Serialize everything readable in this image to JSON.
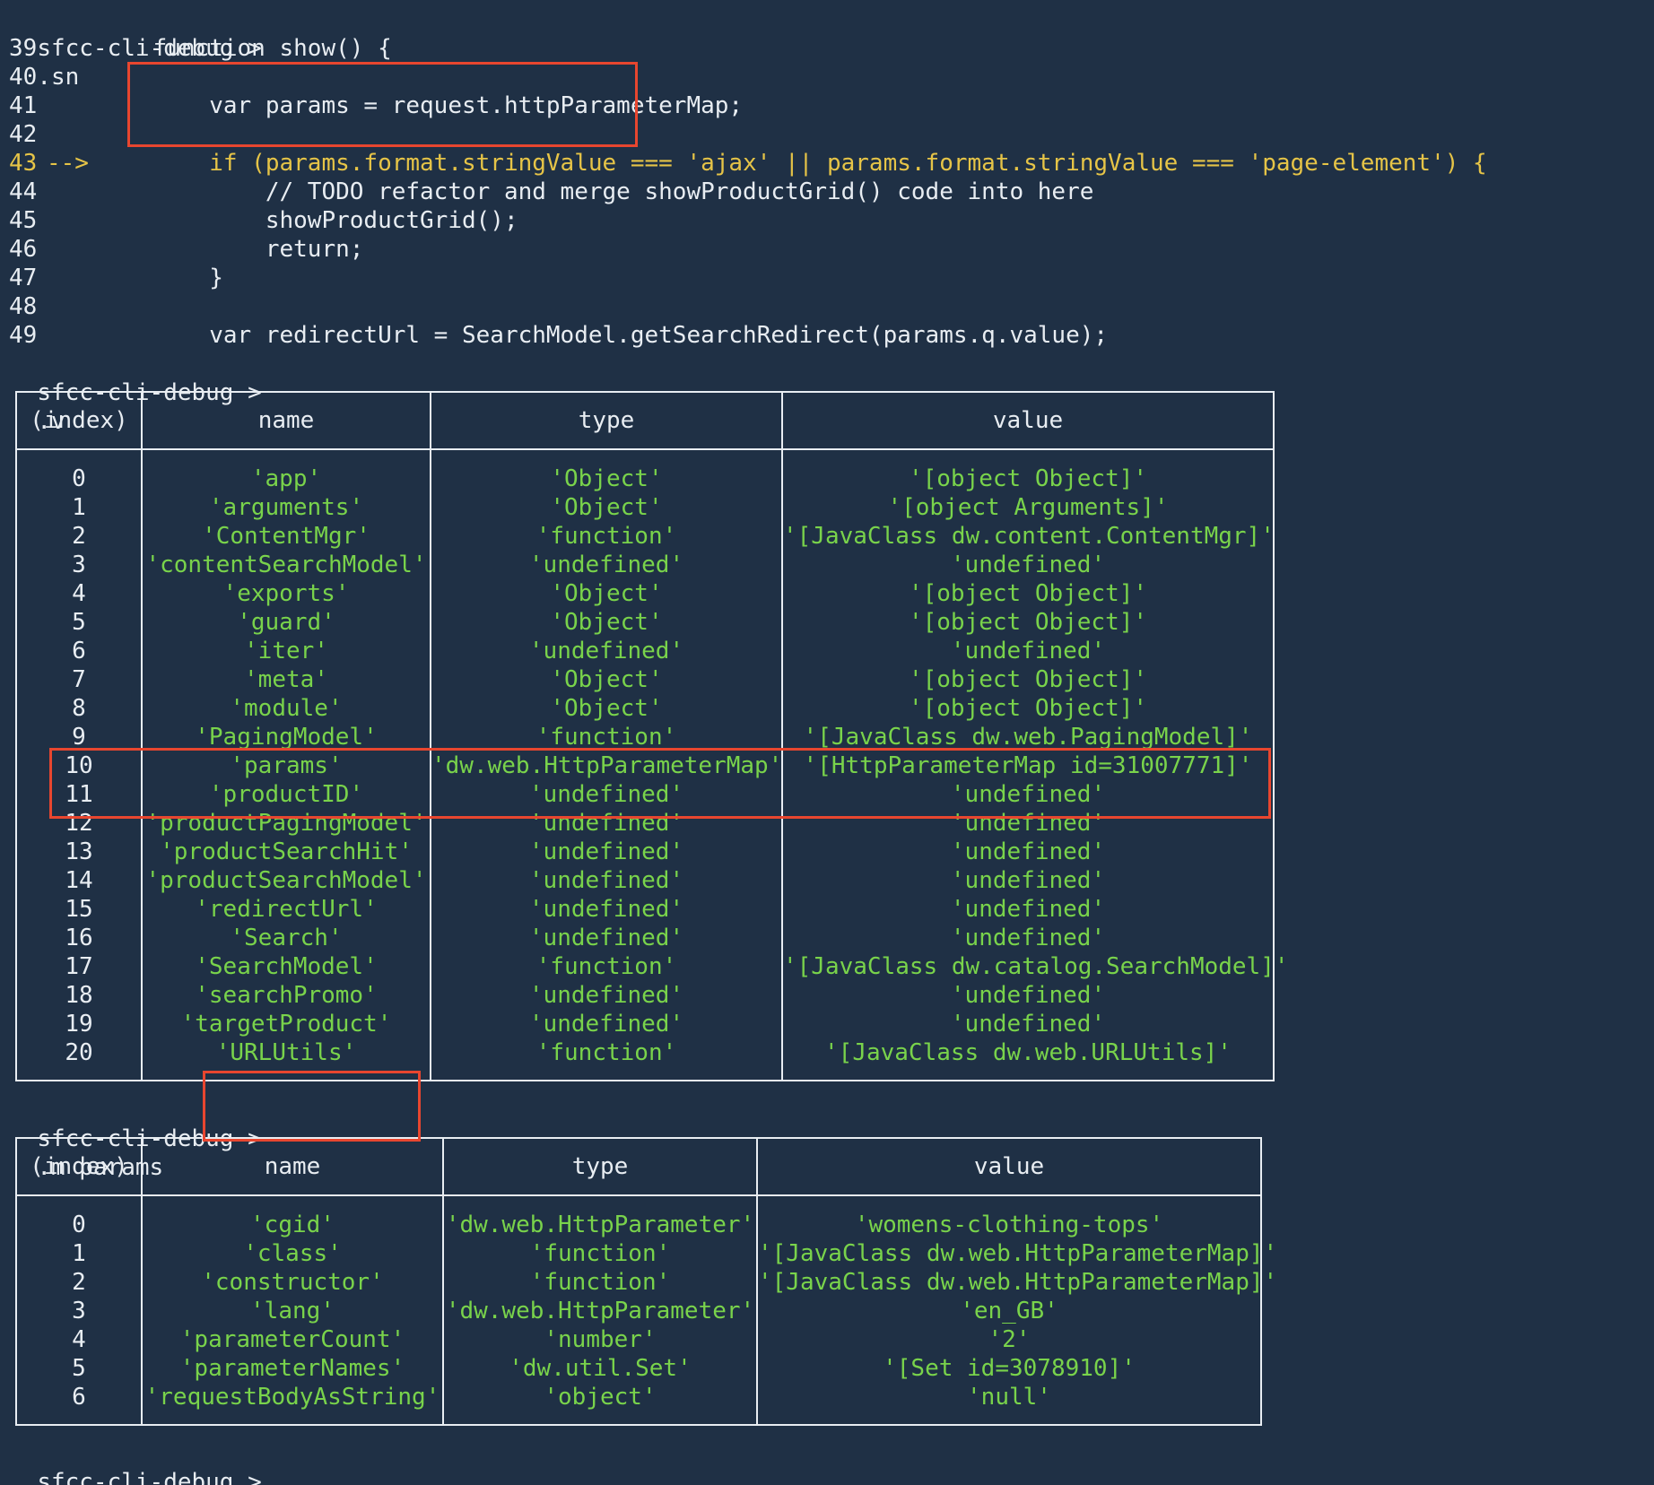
{
  "prompt": "sfcc-cli-debug >",
  "commands": {
    "source": ".sn",
    "variables": ".v",
    "members": ".m params",
    "current": ""
  },
  "code_lines": [
    {
      "num": "39",
      "marker": "",
      "text": "    function show() {"
    },
    {
      "num": "40",
      "marker": "",
      "text": ""
    },
    {
      "num": "41",
      "marker": "",
      "text": "        var params = request.httpParameterMap;"
    },
    {
      "num": "42",
      "marker": "",
      "text": ""
    },
    {
      "num": "43",
      "marker": "-->",
      "text": "        if (params.format.stringValue === 'ajax' || params.format.stringValue === 'page-element') {"
    },
    {
      "num": "44",
      "marker": "",
      "text": "            // TODO refactor and merge showProductGrid() code into here"
    },
    {
      "num": "45",
      "marker": "",
      "text": "            showProductGrid();"
    },
    {
      "num": "46",
      "marker": "",
      "text": "            return;"
    },
    {
      "num": "47",
      "marker": "",
      "text": "        }"
    },
    {
      "num": "48",
      "marker": "",
      "text": ""
    },
    {
      "num": "49",
      "marker": "",
      "text": "        var redirectUrl = SearchModel.getSearchRedirect(params.q.value);"
    }
  ],
  "variables_table": {
    "headers": [
      "(index)",
      "name",
      "type",
      "value"
    ],
    "rows": [
      [
        "0",
        "'app'",
        "'Object'",
        "'[object Object]'"
      ],
      [
        "1",
        "'arguments'",
        "'Object'",
        "'[object Arguments]'"
      ],
      [
        "2",
        "'ContentMgr'",
        "'function'",
        "'[JavaClass dw.content.ContentMgr]'"
      ],
      [
        "3",
        "'contentSearchModel'",
        "'undefined'",
        "'undefined'"
      ],
      [
        "4",
        "'exports'",
        "'Object'",
        "'[object Object]'"
      ],
      [
        "5",
        "'guard'",
        "'Object'",
        "'[object Object]'"
      ],
      [
        "6",
        "'iter'",
        "'undefined'",
        "'undefined'"
      ],
      [
        "7",
        "'meta'",
        "'Object'",
        "'[object Object]'"
      ],
      [
        "8",
        "'module'",
        "'Object'",
        "'[object Object]'"
      ],
      [
        "9",
        "'PagingModel'",
        "'function'",
        "'[JavaClass dw.web.PagingModel]'"
      ],
      [
        "10",
        "'params'",
        "'dw.web.HttpParameterMap'",
        "'[HttpParameterMap id=31007771]'"
      ],
      [
        "11",
        "'productID'",
        "'undefined'",
        "'undefined'"
      ],
      [
        "12",
        "'productPagingModel'",
        "'undefined'",
        "'undefined'"
      ],
      [
        "13",
        "'productSearchHit'",
        "'undefined'",
        "'undefined'"
      ],
      [
        "14",
        "'productSearchModel'",
        "'undefined'",
        "'undefined'"
      ],
      [
        "15",
        "'redirectUrl'",
        "'undefined'",
        "'undefined'"
      ],
      [
        "16",
        "'Search'",
        "'undefined'",
        "'undefined'"
      ],
      [
        "17",
        "'SearchModel'",
        "'function'",
        "'[JavaClass dw.catalog.SearchModel]'"
      ],
      [
        "18",
        "'searchPromo'",
        "'undefined'",
        "'undefined'"
      ],
      [
        "19",
        "'targetProduct'",
        "'undefined'",
        "'undefined'"
      ],
      [
        "20",
        "'URLUtils'",
        "'function'",
        "'[JavaClass dw.web.URLUtils]'"
      ]
    ]
  },
  "members_table": {
    "headers": [
      "(index)",
      "name",
      "type",
      "value"
    ],
    "rows": [
      [
        "0",
        "'cgid'",
        "'dw.web.HttpParameter'",
        "'womens-clothing-tops'"
      ],
      [
        "1",
        "'class'",
        "'function'",
        "'[JavaClass dw.web.HttpParameterMap]'"
      ],
      [
        "2",
        "'constructor'",
        "'function'",
        "'[JavaClass dw.web.HttpParameterMap]'"
      ],
      [
        "3",
        "'lang'",
        "'dw.web.HttpParameter'",
        "'en_GB'"
      ],
      [
        "4",
        "'parameterCount'",
        "'number'",
        "'2'"
      ],
      [
        "5",
        "'parameterNames'",
        "'dw.util.Set'",
        "'[Set id=3078910]'"
      ],
      [
        "6",
        "'requestBodyAsString'",
        "'object'",
        "'null'"
      ]
    ]
  },
  "colors": {
    "background": "#1f3045",
    "text": "#e8edf2",
    "string_value": "#79d34b",
    "current_line": "#e6c447",
    "highlight_box": "#e8462f",
    "cursor": "#f2cf3d"
  }
}
